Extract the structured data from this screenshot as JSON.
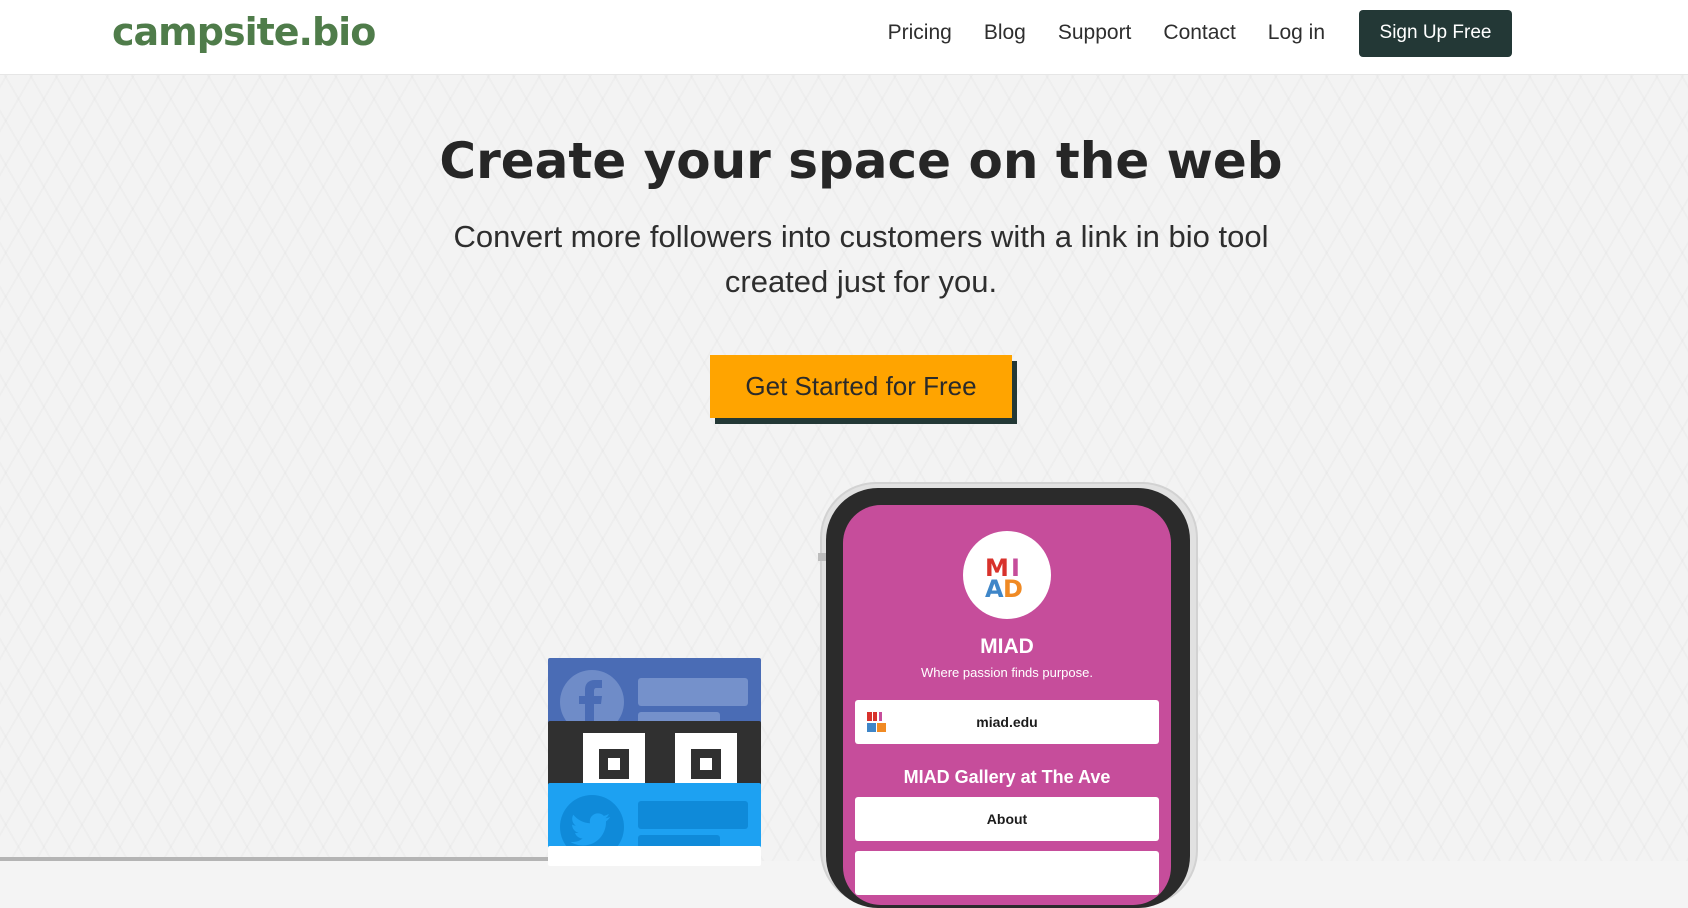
{
  "header": {
    "logo": "campsite.bio",
    "nav": [
      "Pricing",
      "Blog",
      "Support",
      "Contact",
      "Log in"
    ],
    "signup_label": "Sign Up Free"
  },
  "hero": {
    "title": "Create your space on the web",
    "subtitle": "Convert more followers into customers with a link in bio tool created just for you.",
    "cta_label": "Get Started for Free"
  },
  "phone": {
    "avatar_letters": [
      "M",
      "I",
      "A",
      "D"
    ],
    "profile_name": "MIAD",
    "tagline": "Where passion finds purpose.",
    "links": [
      {
        "label": "miad.edu"
      },
      {
        "label": "About"
      }
    ],
    "section_heading": "MIAD Gallery at The Ave"
  },
  "colors": {
    "brand_green": "#4f7c4a",
    "dark_teal": "#233836",
    "cta_orange": "#ffa400",
    "profile_pink": "#c64d9b",
    "facebook_blue": "#4a6cb5",
    "twitter_blue": "#1da1f2"
  },
  "icons": [
    "facebook-icon",
    "qr-code-icon",
    "twitter-icon",
    "miad-logo-icon"
  ]
}
